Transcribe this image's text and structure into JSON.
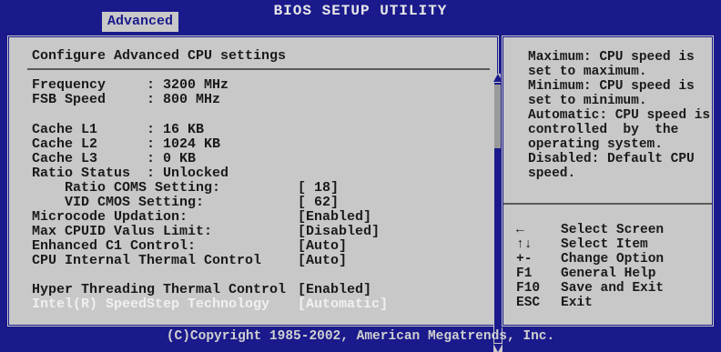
{
  "header": {
    "title": "BIOS SETUP UTILITY",
    "tab": "Advanced"
  },
  "main": {
    "heading": "Configure Advanced CPU settings",
    "rows": [
      {
        "label": "Frequency     : 3200 MHz",
        "value": ""
      },
      {
        "label": "FSB Speed     : 800 MHz",
        "value": ""
      },
      {
        "label": "Cache L1      : 16 KB",
        "value": ""
      },
      {
        "label": "Cache L2      : 1024 KB",
        "value": ""
      },
      {
        "label": "Cache L3      : 0 KB",
        "value": ""
      },
      {
        "label": "Ratio Status  : Unlocked",
        "value": ""
      },
      {
        "label": "    Ratio COMS Setting:",
        "value": "[ 18]"
      },
      {
        "label": "    VID CMOS Setting:",
        "value": "[ 62]"
      },
      {
        "label": "Microcode Updation:",
        "value": "[Enabled]"
      },
      {
        "label": "Max CPUID Valus Limit:",
        "value": "[Disabled]"
      },
      {
        "label": "Enhanced C1 Control:",
        "value": "[Auto]"
      },
      {
        "label": "CPU Internal Thermal Control",
        "value": "[Auto]"
      },
      {
        "label": "Hyper Threading Thermal Control",
        "value": "[Enabled]"
      },
      {
        "label": "Intel(R) SpeedStep Technology",
        "value": "[Automatic]"
      }
    ]
  },
  "help": {
    "text": "Maximum: CPU speed is\nset to maximum.\nMinimum: CPU speed is\nset to minimum.\nAutomatic: CPU speed is\ncontrolled  by  the\noperating system.\nDisabled: Default CPU\nspeed.",
    "keys": [
      {
        "key": "←",
        "desc": "Select Screen"
      },
      {
        "key": "↑↓",
        "desc": "Select Item"
      },
      {
        "key": "+-",
        "desc": "Change Option"
      },
      {
        "key": "F1",
        "desc": "General Help"
      },
      {
        "key": "F10",
        "desc": "Save and Exit"
      },
      {
        "key": "ESC",
        "desc": "Exit"
      }
    ]
  },
  "footer": {
    "copyright": "(C)Copyright 1985-2002, American Megatrends, Inc."
  },
  "colors": {
    "background": "#1a1a8c",
    "panel": "#c8c8c8",
    "text": "#1a1a1a",
    "selected_text": "#f0f0f0"
  }
}
